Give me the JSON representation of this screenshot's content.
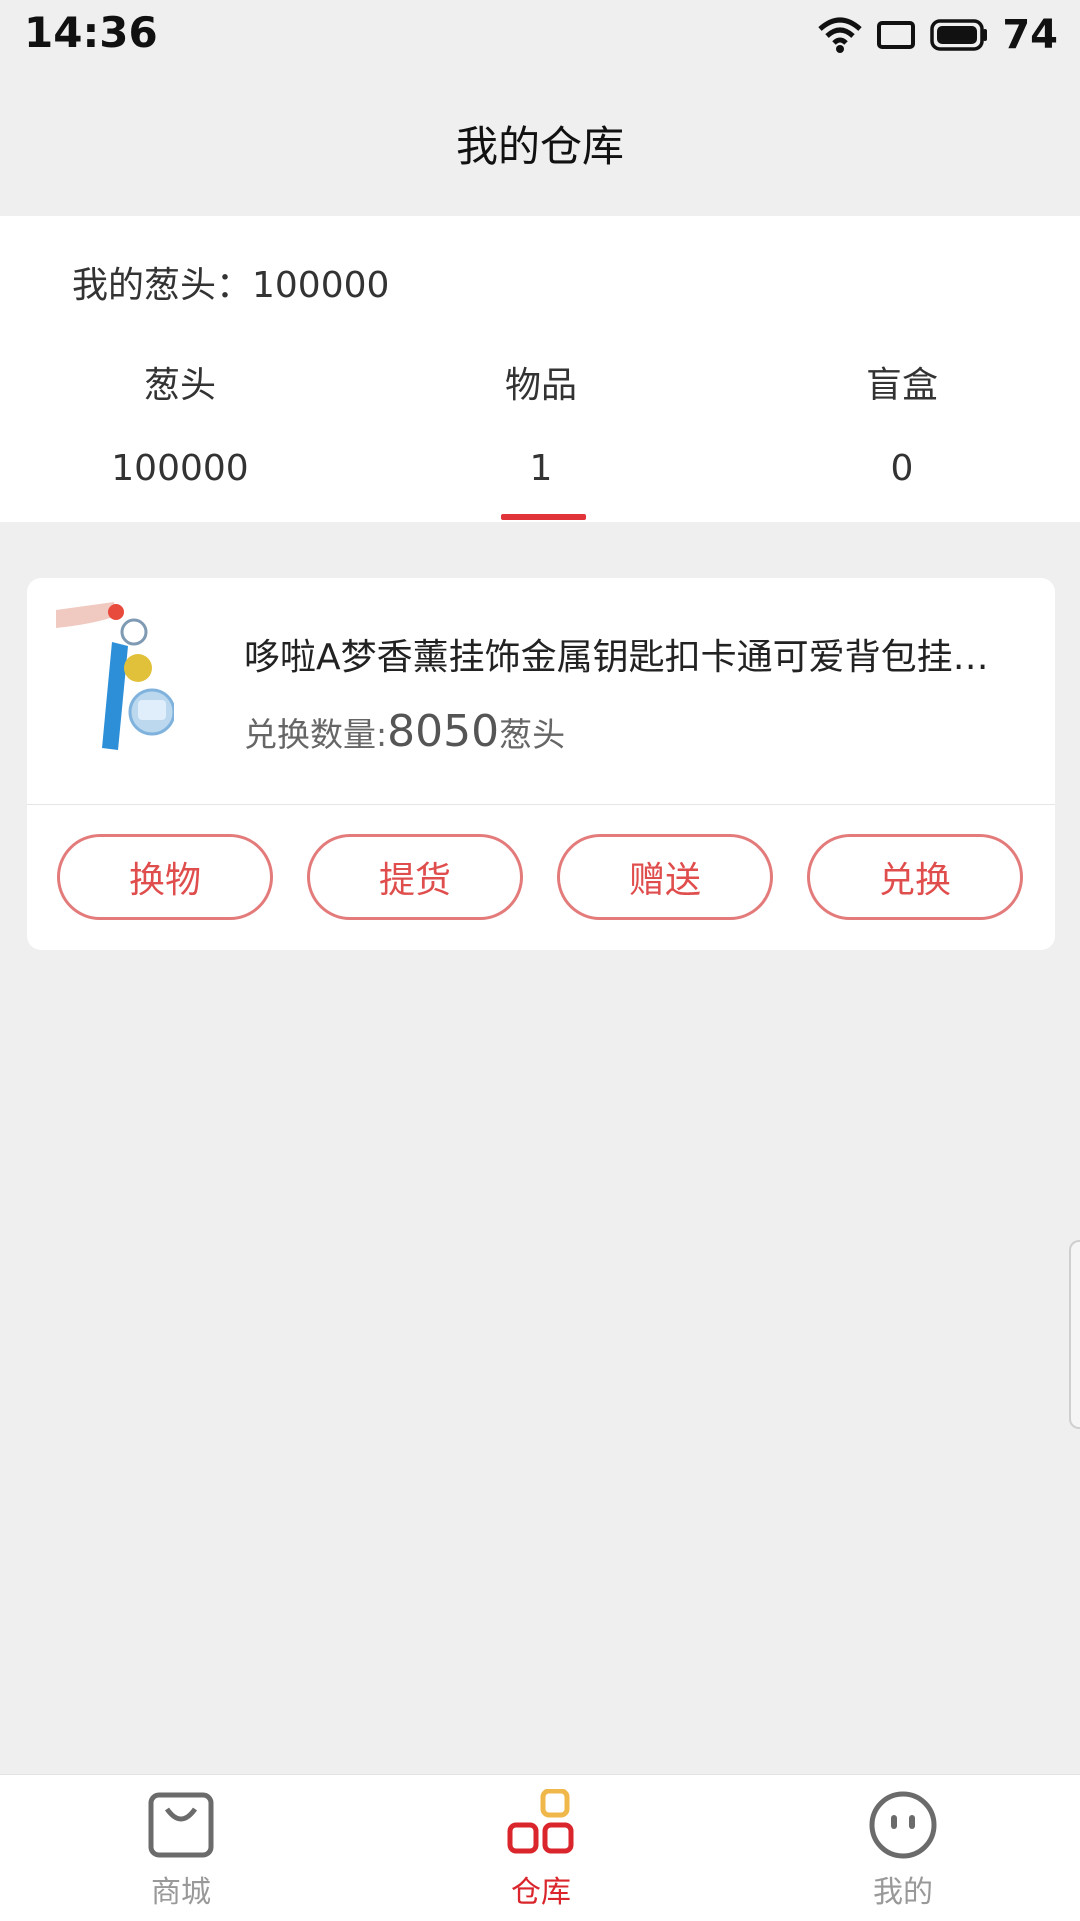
{
  "status_bar": {
    "time": "14:36",
    "battery": "74"
  },
  "header": {
    "title": "我的仓库"
  },
  "summary": {
    "line": "我的葱头：100000",
    "stats": [
      {
        "label": "葱头",
        "value": "100000"
      },
      {
        "label": "物品",
        "value": "1"
      },
      {
        "label": "盲盒",
        "value": "0"
      }
    ],
    "active_index": 1
  },
  "item": {
    "title": "哆啦A梦香薰挂饰金属钥匙扣卡通可爱背包挂…",
    "exchange_prefix": "兑换数量:",
    "exchange_amount": "8050",
    "exchange_unit": "葱头"
  },
  "actions": [
    "换物",
    "提货",
    "赠送",
    "兑换"
  ],
  "tabbar": {
    "items": [
      {
        "label": "商城",
        "icon": "shopping-bag-icon"
      },
      {
        "label": "仓库",
        "icon": "warehouse-blocks-icon"
      },
      {
        "label": "我的",
        "icon": "smiley-face-icon"
      }
    ],
    "active_index": 1
  },
  "colors": {
    "accent": "#d9252b",
    "button_border": "#e37b7b",
    "background": "#efefef"
  }
}
